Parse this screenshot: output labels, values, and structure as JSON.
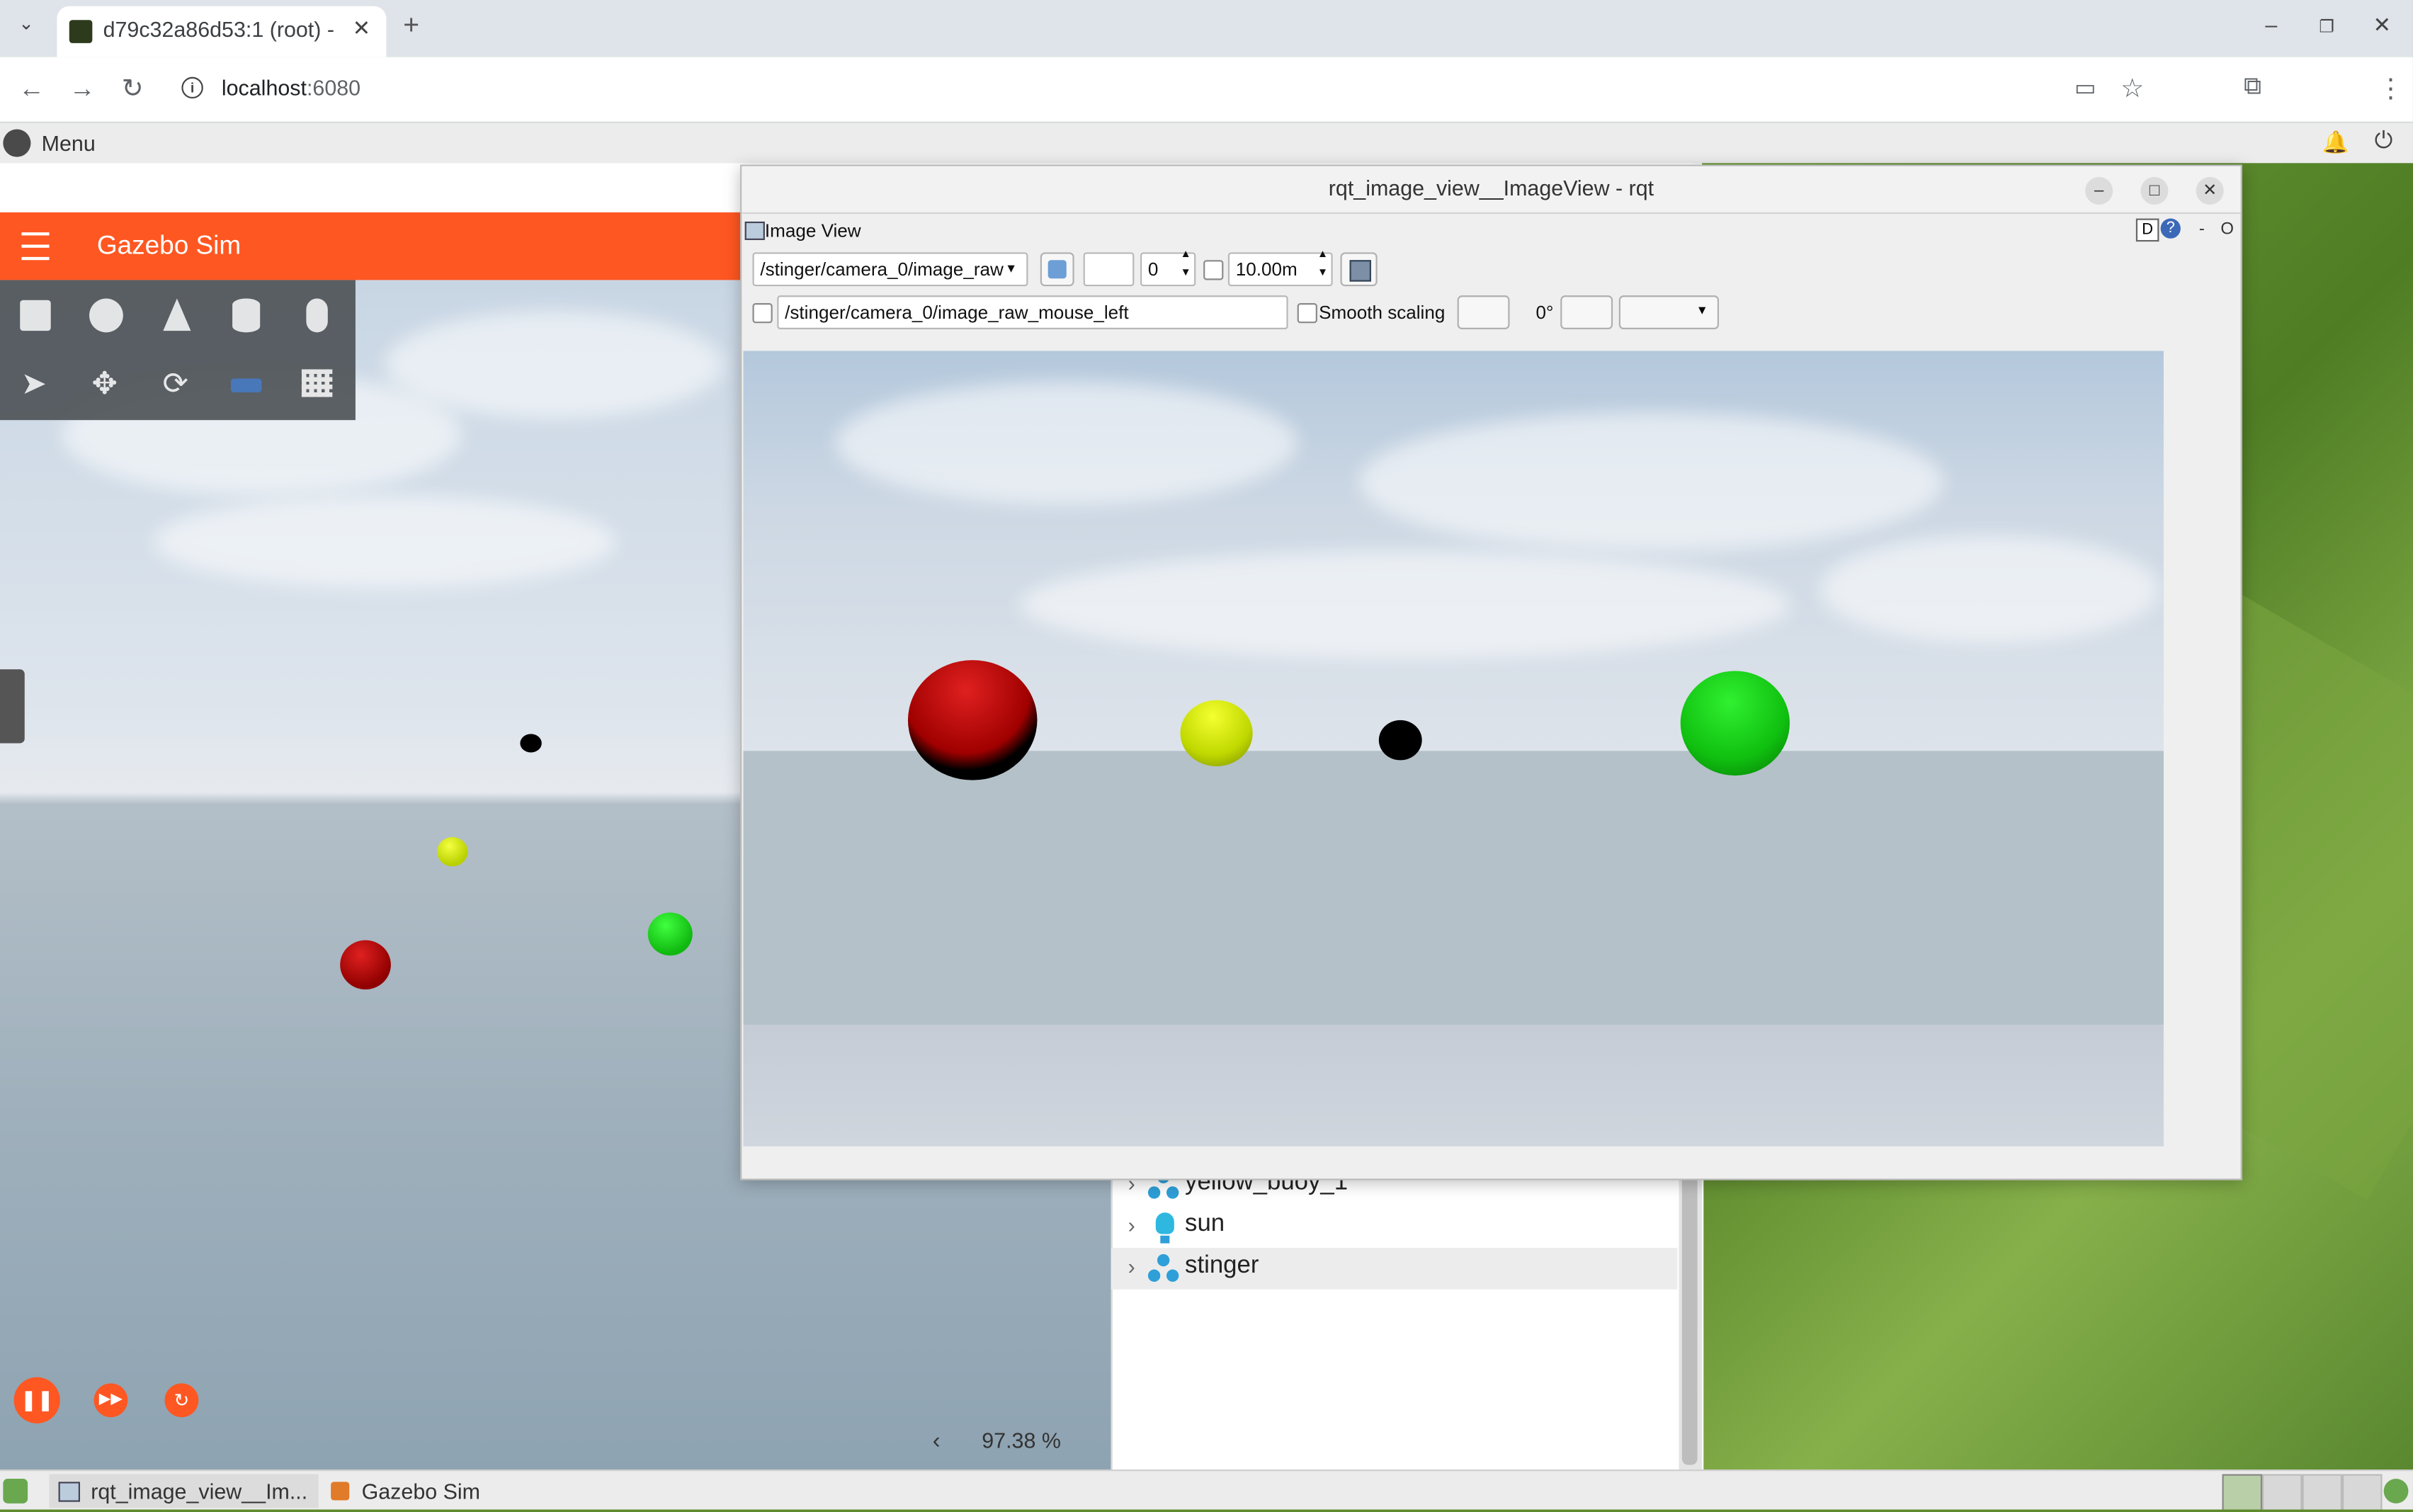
{
  "browser": {
    "tab_title": "d79c32a86d53:1 (root) -",
    "url_host": "localhost",
    "url_port": ":6080"
  },
  "desktop": {
    "menu_label": "Menu"
  },
  "gazebo": {
    "title": "Gazebo Sim",
    "zoom": "97.38 %",
    "entities": [
      {
        "name": "yellow_buoy_1",
        "icon": "model-icon"
      },
      {
        "name": "sun",
        "icon": "light-icon"
      },
      {
        "name": "stinger",
        "icon": "model-icon"
      }
    ]
  },
  "rqt": {
    "window_title": "rqt_image_view__ImageView - rqt",
    "dock_title": "Image View",
    "dock_controls": "D",
    "topic": "/stinger/camera_0/image_raw",
    "spin_value": "0",
    "distance": "10.00m",
    "mouse_topic": "/stinger/camera_0/image_raw_mouse_left",
    "smooth_scaling": "Smooth scaling",
    "rotation": "0°",
    "dock_dash": "-",
    "dock_o": "O"
  },
  "taskbar": {
    "items": [
      "rqt_image_view__Im...",
      "Gazebo Sim"
    ]
  },
  "colors": {
    "gazebo_accent": "#ff5722",
    "red_buoy": "#d01010",
    "yellow_buoy": "#c8e000",
    "green_buoy": "#12cc12",
    "black_buoy": "#000000"
  }
}
